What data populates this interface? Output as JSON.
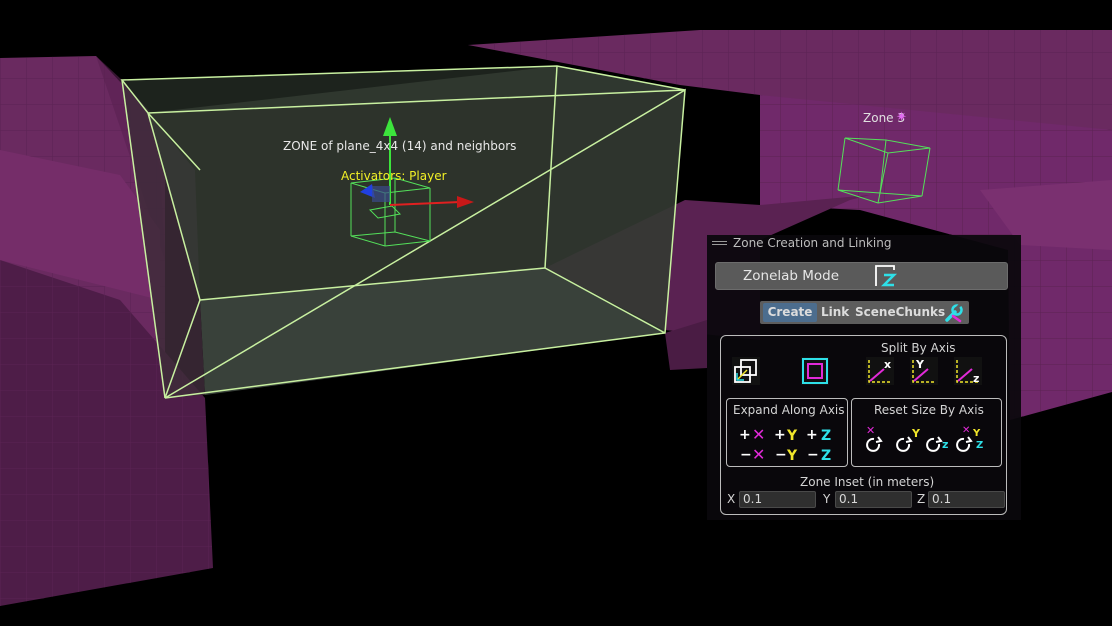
{
  "scene": {
    "zone_label": "ZONE of plane_4x4 (14) and neighbors",
    "activators_label": "Activators: Player",
    "zone3_label": "Zone 3",
    "zone3_icon": "sun-gizmo-icon",
    "colors": {
      "wall": "#6e2a63",
      "zone_edge": "#c8f0a0",
      "gizmo_x": "#e02020",
      "gizmo_y": "#3ce43c",
      "gizmo_z": "#2040e0"
    }
  },
  "panel": {
    "title": "Zone Creation and Linking",
    "mode_label": "Zonelab Mode",
    "mode_icon": "zonelab-z-icon",
    "tabs": [
      {
        "label": "Create",
        "active": true
      },
      {
        "label": "Link",
        "active": false
      },
      {
        "label": "SceneChunks",
        "active": false
      }
    ],
    "settings_icon": "wrench-icon",
    "split_label": "Split By Axis",
    "split_buttons": [
      "X",
      "Y",
      "Z"
    ],
    "expand_label": "Expand Along Axis",
    "expand_buttons": [
      {
        "sign": "+",
        "axis": "X"
      },
      {
        "sign": "+",
        "axis": "Y"
      },
      {
        "sign": "+",
        "axis": "Z"
      },
      {
        "sign": "−",
        "axis": "X"
      },
      {
        "sign": "−",
        "axis": "Y"
      },
      {
        "sign": "−",
        "axis": "Z"
      }
    ],
    "reset_label": "Reset Size By Axis",
    "reset_buttons": [
      "X",
      "Y",
      "Z",
      "XYZ"
    ],
    "inset_label": "Zone Inset (in meters)",
    "inset": {
      "x_label": "X",
      "x_value": "0.1",
      "y_label": "Y",
      "y_value": "0.1",
      "z_label": "Z",
      "z_value": "0.1"
    },
    "colors": {
      "x": "#e22ad8",
      "y": "#f0e52a",
      "z": "#2ee0e8",
      "tab_active": "#4c6d8e"
    }
  }
}
